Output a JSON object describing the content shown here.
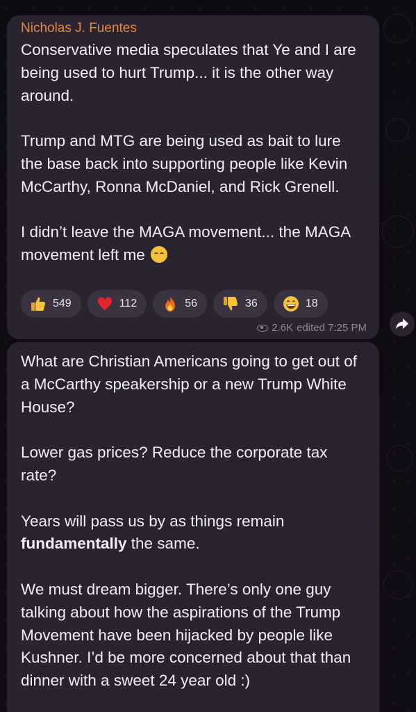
{
  "message1": {
    "sender": "Nicholas J. Fuentes",
    "text": "Conservative media speculates that Ye and I are being used to hurt Trump... it is the other way around.\n\nTrump and MTG are being used as bait to lure the base back into supporting people like Kevin McCarthy, Ronna McDaniel, and Rick Grenell.\n\nI didn’t leave the MAGA movement... the MAGA movement left me",
    "trailing_emoji": "pensive-face-emoji",
    "reactions": [
      {
        "icon": "thumbs-up-icon",
        "count": "549"
      },
      {
        "icon": "red-heart-icon",
        "count": "112"
      },
      {
        "icon": "fire-icon",
        "count": "56"
      },
      {
        "icon": "thumbs-down-icon",
        "count": "36"
      },
      {
        "icon": "grinning-face-icon",
        "count": "18"
      }
    ],
    "views": "2.6K",
    "status": "edited 7:25 PM"
  },
  "message2": {
    "para1": "What are Christian Americans going to get out of a McCarthy speakership or a new Trump White House?",
    "para2": "Lower gas prices? Reduce the corporate tax rate?",
    "para3_before": "Years will pass us by as things remain ",
    "para3_bold": "fundamentally",
    "para3_after": " the same.",
    "para4": "We must dream bigger. There’s only one guy talking about how the aspirations of the Trump Movement have been hijacked by people like Kushner. I’d be more concerned about that than dinner with a sweet 24 year old :)"
  },
  "colors": {
    "background": "#0d0b12",
    "bubble": "#2a2331",
    "sender_name": "#e58a3a",
    "text": "#f2eef5",
    "meta": "#8e8797",
    "reaction_pill": "#3b3342"
  }
}
